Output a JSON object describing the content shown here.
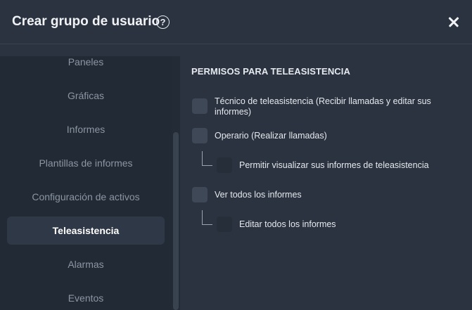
{
  "dialog": {
    "title": "Crear grupo de usuario",
    "help_icon": "question-circle-icon",
    "close_icon": "close-icon"
  },
  "sidebar": {
    "items": [
      {
        "label": "Paneles"
      },
      {
        "label": "Gráficas"
      },
      {
        "label": "Informes"
      },
      {
        "label": "Plantillas de informes"
      },
      {
        "label": "Configuración de activos"
      },
      {
        "label": "Teleasistencia"
      },
      {
        "label": "Alarmas"
      },
      {
        "label": "Eventos"
      }
    ],
    "active": "Teleasistencia"
  },
  "permissions": {
    "section_title": "PERMISOS PARA TELEASISTENCIA",
    "items": [
      {
        "label": "Técnico de teleasistencia (Recibir llamadas y editar sus informes)",
        "checked": false
      },
      {
        "label": "Operario (Realizar llamadas)",
        "checked": false
      },
      {
        "label": "Permitir visualizar sus informes de teleasistencia",
        "checked": false
      },
      {
        "label": "Ver todos los informes",
        "checked": false
      },
      {
        "label": "Editar todos los informes",
        "checked": false
      }
    ]
  },
  "colors": {
    "background": "#2b3340",
    "sidebar": "#222a35",
    "active_item": "#2f3846",
    "checkbox": "#3e4857"
  }
}
